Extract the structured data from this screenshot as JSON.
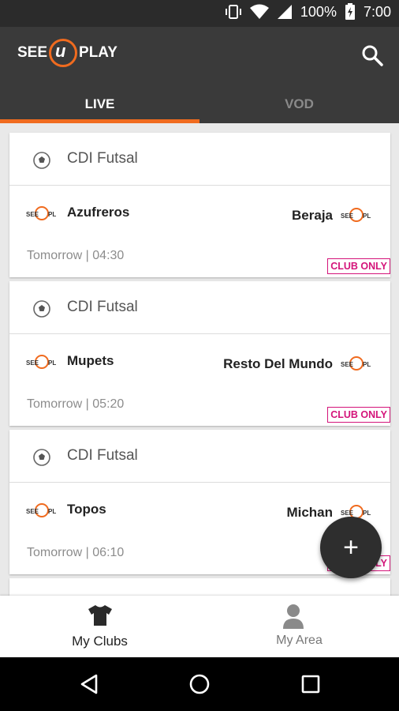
{
  "status": {
    "battery": "100%",
    "time": "7:00"
  },
  "app": {
    "logo_left": "SEE",
    "logo_u": "u",
    "logo_right": "PLAY"
  },
  "tabs": [
    {
      "label": "LIVE"
    },
    {
      "label": "VOD"
    }
  ],
  "matches": [
    {
      "competition": "CDI Futsal",
      "home": "Azufreros",
      "away": "Beraja",
      "time": "Tomorrow | 04:30",
      "badge": "CLUB ONLY"
    },
    {
      "competition": "CDI Futsal",
      "home": "Mupets",
      "away": "Resto Del Mundo",
      "time": "Tomorrow | 05:20",
      "badge": "CLUB ONLY"
    },
    {
      "competition": "CDI Futsal",
      "home": "Topos",
      "away": "Michan",
      "time": "Tomorrow | 06:10",
      "badge": "CLUB ONLY"
    }
  ],
  "fab": {
    "icon": "plus-icon",
    "symbol": "+"
  },
  "bottom_nav": [
    {
      "label": "My Clubs",
      "icon": "tshirt-icon"
    },
    {
      "label": "My Area",
      "icon": "person-icon"
    }
  ],
  "colors": {
    "accent": "#f06b1f",
    "badge": "#d4147a",
    "appbar": "#3a3a3a"
  }
}
